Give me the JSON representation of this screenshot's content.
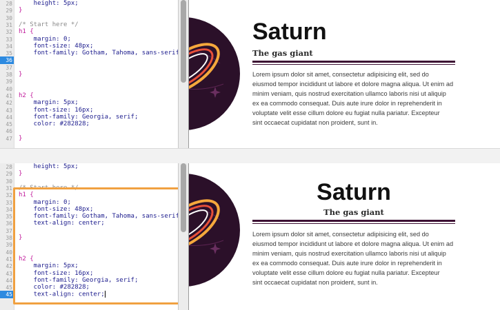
{
  "top": {
    "code_lines": [
      {
        "num": "28",
        "text": "    height: 5px;",
        "kind": "prop"
      },
      {
        "num": "29",
        "text": "}",
        "kind": "brace"
      },
      {
        "num": "30",
        "text": "",
        "kind": "blank"
      },
      {
        "num": "31",
        "text": "/* Start here */",
        "kind": "comment"
      },
      {
        "num": "32",
        "text": "h1 {",
        "kind": "selector"
      },
      {
        "num": "33",
        "text": "    margin: 0;",
        "kind": "prop"
      },
      {
        "num": "34",
        "text": "    font-size: 48px;",
        "kind": "prop"
      },
      {
        "num": "35",
        "text": "    font-family: Gotham, Tahoma, sans-serif;",
        "kind": "prop"
      },
      {
        "num": "36",
        "text": "",
        "kind": "blank",
        "active": true
      },
      {
        "num": "37",
        "text": "",
        "kind": "blank"
      },
      {
        "num": "38",
        "text": "}",
        "kind": "brace"
      },
      {
        "num": "39",
        "text": "",
        "kind": "blank"
      },
      {
        "num": "40",
        "text": "",
        "kind": "blank"
      },
      {
        "num": "41",
        "text": "h2 {",
        "kind": "selector"
      },
      {
        "num": "42",
        "text": "    margin: 5px;",
        "kind": "prop"
      },
      {
        "num": "43",
        "text": "    font-size: 16px;",
        "kind": "prop"
      },
      {
        "num": "44",
        "text": "    font-family: Georgia, serif;",
        "kind": "prop"
      },
      {
        "num": "45",
        "text": "    color: #282828;",
        "kind": "prop"
      },
      {
        "num": "46",
        "text": "",
        "kind": "blank"
      },
      {
        "num": "47",
        "text": "}",
        "kind": "brace"
      }
    ]
  },
  "bottom": {
    "code_lines": [
      {
        "num": "28",
        "text": "    height: 5px;",
        "kind": "prop"
      },
      {
        "num": "29",
        "text": "}",
        "kind": "brace"
      },
      {
        "num": "30",
        "text": "",
        "kind": "blank"
      },
      {
        "num": "31",
        "text": "/* Start here */",
        "kind": "comment"
      },
      {
        "num": "32",
        "text": "h1 {",
        "kind": "selector"
      },
      {
        "num": "33",
        "text": "    margin: 0;",
        "kind": "prop"
      },
      {
        "num": "34",
        "text": "    font-size: 48px;",
        "kind": "prop"
      },
      {
        "num": "35",
        "text": "    font-family: Gotham, Tahoma, sans-serif;",
        "kind": "prop"
      },
      {
        "num": "36",
        "text": "    text-align: center;",
        "kind": "prop"
      },
      {
        "num": "37",
        "text": "",
        "kind": "blank"
      },
      {
        "num": "38",
        "text": "}",
        "kind": "brace"
      },
      {
        "num": "39",
        "text": "",
        "kind": "blank"
      },
      {
        "num": "40",
        "text": "",
        "kind": "blank"
      },
      {
        "num": "41",
        "text": "h2 {",
        "kind": "selector"
      },
      {
        "num": "42",
        "text": "    margin: 5px;",
        "kind": "prop"
      },
      {
        "num": "43",
        "text": "    font-size: 16px;",
        "kind": "prop"
      },
      {
        "num": "44",
        "text": "    font-family: Georgia, serif;",
        "kind": "prop"
      },
      {
        "num": "45",
        "text": "    color: #282828;",
        "kind": "prop"
      },
      {
        "num": "45",
        "text": "    text-align: center;",
        "kind": "prop",
        "active": true,
        "caret": true
      }
    ]
  },
  "preview": {
    "title": "Saturn",
    "subtitle": "The gas giant",
    "body_lines": [
      "Lorem ipsum dolor sit amet, consectetur adipisicing elit, sed do",
      "eiusmod tempor incididunt ut labore et dolore magna aliqua. Ut enim ad",
      "minim veniam, quis nostrud exercitation ullamco laboris nisi ut aliquip",
      "ex ea commodo consequat. Duis aute irure dolor in reprehenderit in",
      "voluptate velit esse cillum dolore eu fugiat nulla pariatur. Excepteur",
      "sint occaecat cupidatat non proident, sunt in."
    ]
  },
  "colors": {
    "selector": "#c0189a",
    "property": "#1a1a8c",
    "comment": "#8a8a8a",
    "accent_rule": "#3d1033",
    "highlight_box": "#f0a040",
    "active_line": "#2d8ae0"
  }
}
